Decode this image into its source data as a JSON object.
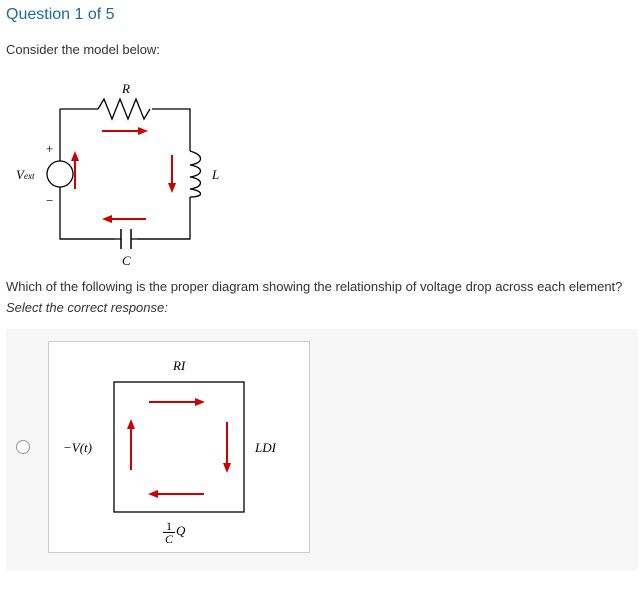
{
  "header": "Question 1 of 5",
  "prompt": "Consider the model below:",
  "question": "Which of the following is the proper diagram showing the relationship of voltage drop across each element?",
  "select_text": "Select the correct response:",
  "circuit": {
    "R": "R",
    "L": "L",
    "C": "C",
    "Vext": "V",
    "Vext_sub": "ext",
    "plus": "+",
    "minus": "−"
  },
  "option1": {
    "top": "RI",
    "right": "LDI",
    "left": "−V(t)",
    "bottom_num": "1",
    "bottom_den": "C",
    "bottom_Q": "Q"
  }
}
